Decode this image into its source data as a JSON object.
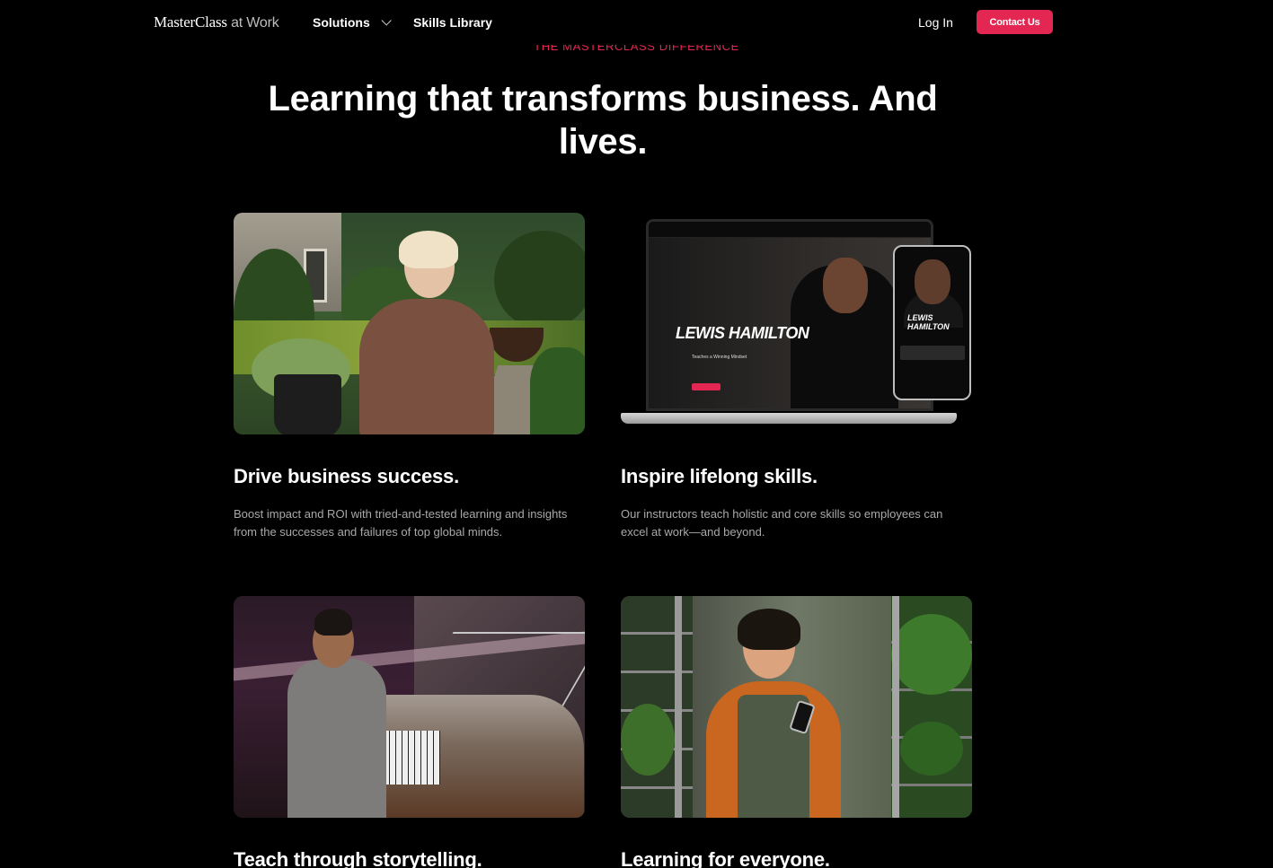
{
  "nav": {
    "logo_main": "MasterClass",
    "logo_suffix": " at Work",
    "solutions_label": "Solutions",
    "skills_label": "Skills Library",
    "login_label": "Log In",
    "contact_label": "Contact Us"
  },
  "hero": {
    "eyebrow": "THE MASTERCLASS DIFFERENCE",
    "headline": "Learning that transforms business. And lives."
  },
  "cards": [
    {
      "title": "Drive business success.",
      "description": "Boost impact and ROI with tried-and-tested learning and insights from the successes and failures of top global minds."
    },
    {
      "title": "Inspire lifelong skills.",
      "description": "Our instructors teach holistic and core skills so employees can excel at work—and beyond.",
      "device_screen": {
        "laptop_name": "LEWIS HAMILTON",
        "laptop_subtitle": "Teaches a Winning Mindset",
        "phone_name": "LEWIS HAMILTON"
      }
    },
    {
      "title": "Teach through storytelling."
    },
    {
      "title": "Learning for everyone."
    }
  ],
  "colors": {
    "accent": "#e32652",
    "background": "#000000",
    "muted_text": "#a9a9a9"
  }
}
